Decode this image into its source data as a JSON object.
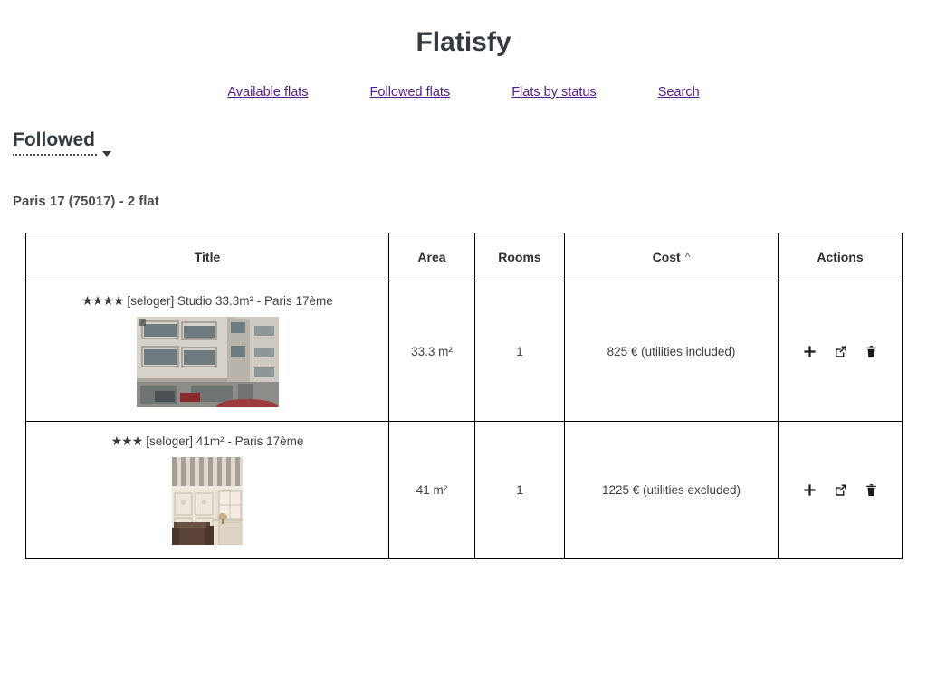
{
  "header": {
    "app_title": "Flatisfy"
  },
  "nav": {
    "items": [
      {
        "label": "Available flats",
        "name": "nav-available-flats"
      },
      {
        "label": "Followed flats",
        "name": "nav-followed-flats"
      },
      {
        "label": "Flats by status",
        "name": "nav-flats-by-status"
      },
      {
        "label": "Search",
        "name": "nav-search"
      }
    ],
    "link_color": "#551a8b"
  },
  "section": {
    "title": "Followed",
    "caret_icon": "chevron-down-icon",
    "subheading": "Paris 17 (75017) - 2 flat"
  },
  "table": {
    "columns": [
      {
        "label": "Title",
        "name": "column-title"
      },
      {
        "label": "Area",
        "name": "column-area"
      },
      {
        "label": "Rooms",
        "name": "column-rooms"
      },
      {
        "label": "Cost",
        "name": "column-cost"
      },
      {
        "label": "Actions",
        "name": "column-actions"
      }
    ],
    "sort": {
      "column": "Cost",
      "direction": "asc",
      "indicator": "^"
    },
    "rows": [
      {
        "stars": 4,
        "stars_glyphs": "★★★★",
        "title": "[seloger] Studio 33.3m² - Paris 17ème",
        "area": "33.3 m²",
        "rooms": "1",
        "cost": "825 € (utilities included)",
        "thumbnail_alt": "building-facade-photo",
        "actions": [
          {
            "label": "add",
            "icon": "plus-icon"
          },
          {
            "label": "open",
            "icon": "external-link-icon"
          },
          {
            "label": "delete",
            "icon": "trash-icon"
          }
        ]
      },
      {
        "stars": 3,
        "stars_glyphs": "★★★",
        "title": "[seloger] 41m² - Paris 17ème",
        "area": "41 m²",
        "rooms": "1",
        "cost": "1225 € (utilities excluded)",
        "thumbnail_alt": "interior-room-photo",
        "actions": [
          {
            "label": "add",
            "icon": "plus-icon"
          },
          {
            "label": "open",
            "icon": "external-link-icon"
          },
          {
            "label": "delete",
            "icon": "trash-icon"
          }
        ]
      }
    ]
  }
}
